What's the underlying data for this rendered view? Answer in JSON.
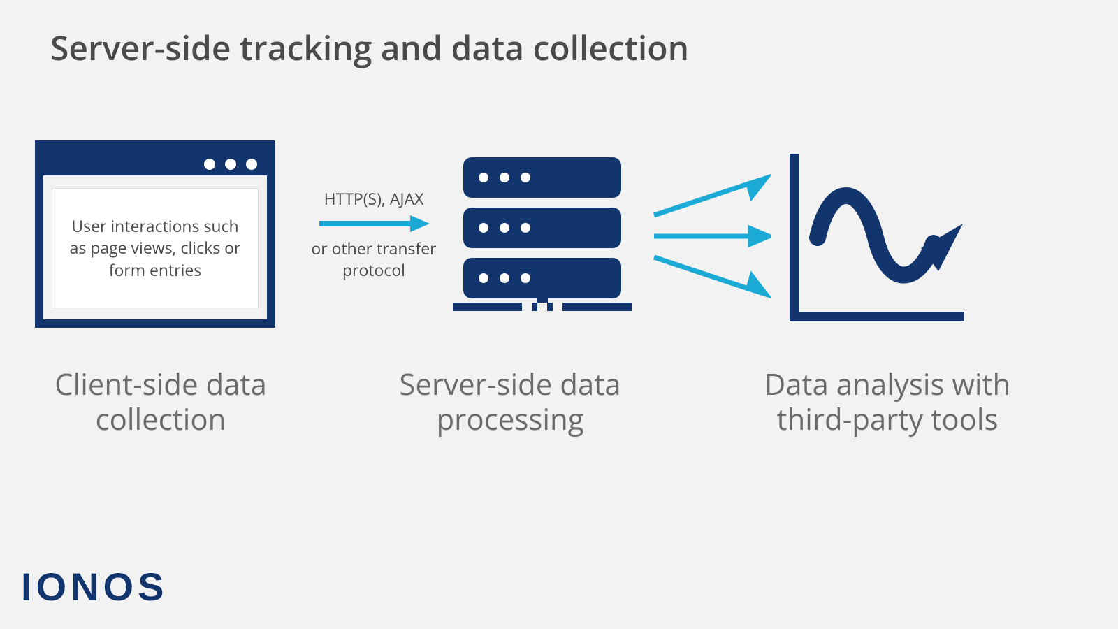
{
  "colors": {
    "brand_dark": "#13356E",
    "accent": "#1BA9D6",
    "text": "#4A4A4A",
    "bg": "#F2F2F2"
  },
  "title": "Server-side tracking and data collection",
  "browser": {
    "content_text": "User interactions such as page views, clicks or form entries"
  },
  "connector1": {
    "label_top": "HTTP(S), AJAX",
    "label_bottom": "or other transfer protocol"
  },
  "captions": {
    "client": "Client-side data collection",
    "server": "Server-side data processing",
    "analysis": "Data analysis with third-party tools"
  },
  "logo": "IONOS"
}
